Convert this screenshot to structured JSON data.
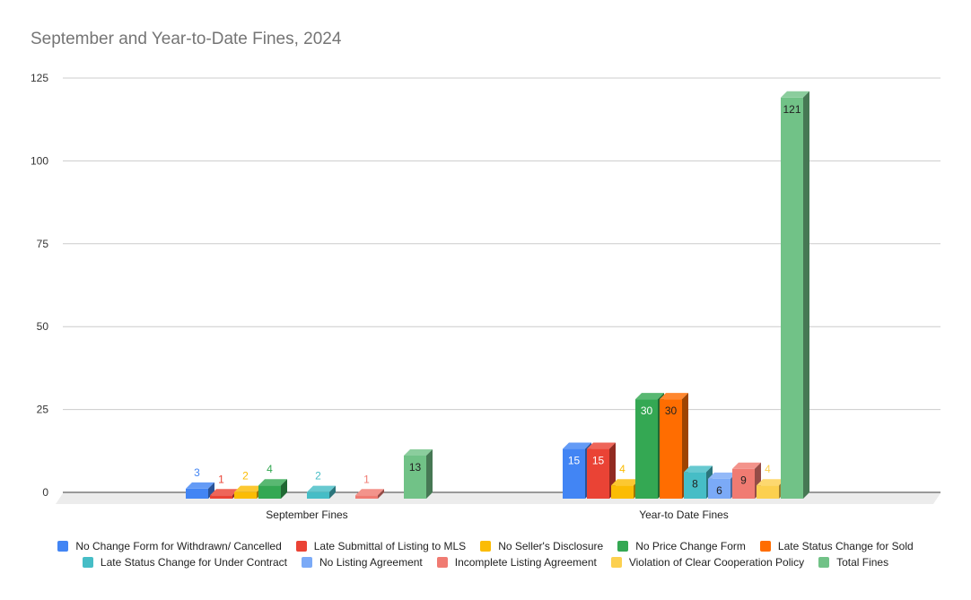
{
  "chart_data": {
    "type": "bar",
    "style": "3d-column",
    "title": "September and Year-to-Date Fines, 2024",
    "xlabel": "",
    "ylabel": "",
    "ylim": [
      0,
      125
    ],
    "yticks": [
      0,
      25,
      50,
      75,
      100,
      125
    ],
    "grid": true,
    "legend_position": "bottom",
    "categories": [
      "September Fines",
      "Year-to Date Fines"
    ],
    "series": [
      {
        "name": "No Change Form for Withdrawn/ Cancelled",
        "color": "#4285f4",
        "values": [
          3,
          15
        ],
        "labels": [
          "3",
          "15"
        ]
      },
      {
        "name": "Late Submittal of Listing to MLS",
        "color": "#ea4335",
        "values": [
          1,
          15
        ],
        "labels": [
          "1",
          "15"
        ]
      },
      {
        "name": "No Seller's Disclosure",
        "color": "#fbbc04",
        "values": [
          2,
          4
        ],
        "labels": [
          "2",
          "4"
        ]
      },
      {
        "name": "No Price Change Form",
        "color": "#34a853",
        "values": [
          4,
          30
        ],
        "labels": [
          "4",
          "30"
        ]
      },
      {
        "name": "Late Status Change for Sold",
        "color": "#ff6d01",
        "values": [
          0,
          30
        ],
        "labels": [
          "",
          "30"
        ]
      },
      {
        "name": "Late Status Change for Under Contract",
        "color": "#46bdc6",
        "values": [
          2,
          8
        ],
        "labels": [
          "2",
          "8"
        ]
      },
      {
        "name": "No Listing Agreement",
        "color": "#7baaf7",
        "values": [
          0,
          6
        ],
        "labels": [
          "",
          "6"
        ]
      },
      {
        "name": "Incomplete Listing Agreement",
        "color": "#f07b72",
        "values": [
          1,
          9
        ],
        "labels": [
          "1",
          "9"
        ]
      },
      {
        "name": "Violation of Clear Cooperation Policy",
        "color": "#fcd04f",
        "values": [
          0,
          4
        ],
        "labels": [
          "",
          "4"
        ]
      },
      {
        "name": "Total Fines",
        "color": "#71c287",
        "values": [
          13,
          121
        ],
        "labels": [
          "13",
          "121"
        ]
      }
    ]
  }
}
